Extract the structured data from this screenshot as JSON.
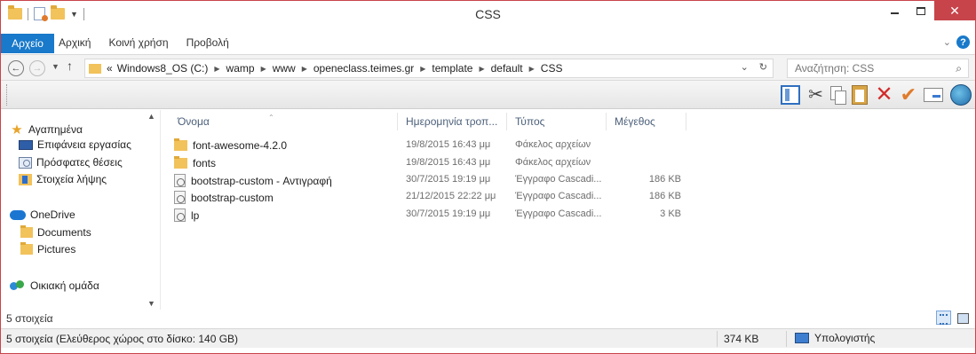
{
  "window": {
    "title": "CSS"
  },
  "ribbon": {
    "file_tab": "Αρχείο",
    "tabs": [
      "Αρχική",
      "Κοινή χρήση",
      "Προβολή"
    ]
  },
  "address": {
    "prefix": "«",
    "crumbs": [
      "Windows8_OS (C:)",
      "wamp",
      "www",
      "openeclass.teimes.gr",
      "template",
      "default",
      "CSS"
    ]
  },
  "search": {
    "placeholder": "Αναζήτηση: CSS"
  },
  "sidebar": {
    "favorites": "Αγαπημένα",
    "items": [
      {
        "label": "Επιφάνεια εργασίας",
        "icon": "desktop-icon"
      },
      {
        "label": "Πρόσφατες θέσεις",
        "icon": "recent-places-icon"
      },
      {
        "label": "Στοιχεία λήψης",
        "icon": "downloads-icon"
      }
    ],
    "onedrive": "OneDrive",
    "onedrive_items": [
      "Documents",
      "Pictures"
    ],
    "homegroup": "Οικιακή ομάδα"
  },
  "columns": {
    "name": "Όνομα",
    "date": "Ημερομηνία τροπ...",
    "type": "Τύπος",
    "size": "Μέγεθος"
  },
  "files": [
    {
      "name": "font-awesome-4.2.0",
      "date": "19/8/2015 16:43 μμ",
      "type": "Φάκελος αρχείων",
      "size": "",
      "icon": "folder-icon"
    },
    {
      "name": "fonts",
      "date": "19/8/2015 16:43 μμ",
      "type": "Φάκελος αρχείων",
      "size": "",
      "icon": "folder-icon"
    },
    {
      "name": "bootstrap-custom - Αντιγραφή",
      "date": "30/7/2015 19:19 μμ",
      "type": "Έγγραφο Cascadi...",
      "size": "186 KB",
      "icon": "css-file-icon"
    },
    {
      "name": "bootstrap-custom",
      "date": "21/12/2015 22:22 μμ",
      "type": "Έγγραφο Cascadi...",
      "size": "186 KB",
      "icon": "css-file-icon"
    },
    {
      "name": "lp",
      "date": "30/7/2015 19:19 μμ",
      "type": "Έγγραφο Cascadi...",
      "size": "3 KB",
      "icon": "css-file-icon"
    }
  ],
  "item_count": "5 στοιχεία",
  "status": {
    "left": "5 στοιχεία (Ελεύθερος χώρος στο δίσκο: 140 GB)",
    "size": "374 KB",
    "location": "Υπολογιστής"
  },
  "colors": {
    "file_tab": "#1979ca",
    "close_button": "#c7444a",
    "window_border": "#c9434b"
  }
}
